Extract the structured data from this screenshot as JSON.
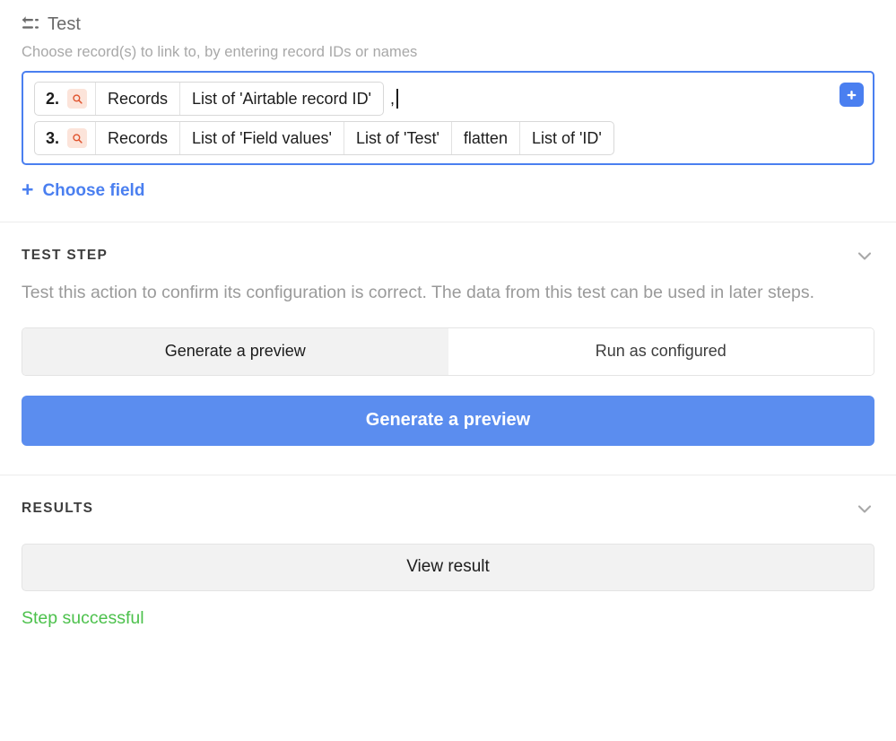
{
  "field": {
    "icon": "sliders-icon",
    "title": "Test",
    "help": "Choose record(s) to link to, by entering record IDs or names",
    "tokens": [
      {
        "step": "2.",
        "app_icon": "search-icon",
        "segments": [
          "Records",
          "List of 'Airtable record ID'"
        ],
        "trailing_text": ",",
        "caret": true
      },
      {
        "step": "3.",
        "app_icon": "search-icon",
        "segments": [
          "Records",
          "List of 'Field values'",
          "List of 'Test'",
          "flatten",
          "List of 'ID'"
        ],
        "trailing_text": "",
        "caret": false
      }
    ],
    "add_token_button": "+",
    "choose_field": {
      "plus": "+",
      "label": "Choose field"
    }
  },
  "test_step": {
    "title": "TEST STEP",
    "collapse_icon": "chevron-down-icon",
    "description": "Test this action to confirm its configuration is correct. The data from this test can be used in later steps.",
    "modes": [
      {
        "label": "Generate a preview",
        "selected": true
      },
      {
        "label": "Run as configured",
        "selected": false
      }
    ],
    "primary_button": "Generate a preview"
  },
  "results": {
    "title": "RESULTS",
    "collapse_icon": "chevron-down-icon",
    "view_result_button": "View result",
    "status": "Step successful"
  },
  "colors": {
    "accent_blue": "#4a7ff0",
    "primary_button_blue": "#5b8def",
    "success_green": "#4cc14c",
    "app_badge_bg": "#fce4da",
    "app_badge_fg": "#e0542f",
    "muted_text": "#9a9a9a",
    "divider": "#ececec"
  }
}
